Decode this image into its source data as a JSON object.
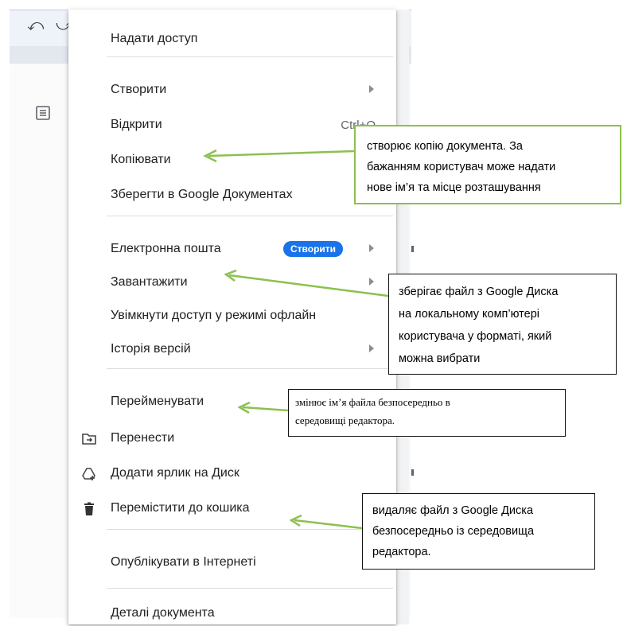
{
  "colors": {
    "accent": "#1a73e8",
    "callout_arrow": "#8cc04f"
  },
  "toolbar": {
    "undo_icon": "undo-icon",
    "redo_icon": "redo-icon"
  },
  "menu": {
    "share": {
      "label": "Надати доступ"
    },
    "create": {
      "label": "Створити"
    },
    "open": {
      "label": "Відкрити",
      "shortcut": "Ctrl+O"
    },
    "copy": {
      "label": "Копіювати"
    },
    "save_docs": {
      "label": "Зберегти в Google Документах"
    },
    "email": {
      "label": "Електронна пошта",
      "badge": "Створити"
    },
    "download": {
      "label": "Завантажити"
    },
    "offline": {
      "label": "Увімкнути доступ у режимі офлайн"
    },
    "history": {
      "label": "Історія версій"
    },
    "rename": {
      "label": "Перейменувати"
    },
    "move": {
      "label": "Перенести",
      "icon": "move-folder-icon"
    },
    "shortcut_add": {
      "label": "Додати ярлик на Диск",
      "icon": "add-drive-shortcut-icon"
    },
    "trash": {
      "label": "Перемістити до кошика",
      "icon": "trash-icon"
    },
    "publish": {
      "label": "Опублікувати в Інтернеті"
    },
    "details": {
      "label": "Деталі документа"
    }
  },
  "callouts": {
    "copy": "створює копію документа. За\nбажанням користувач може надати\nнове ім’я та місце розташування",
    "download": "зберігає файл з Google Диска\nна локальному комп’ютері\nкористувача у форматі, який\nможна вибрати",
    "rename": "змінює ім’я файла безпосередньо в\nсередовищі редактора.",
    "trash": "видаляє файл з Google Диска\nбезпосередньо із середовища\nредактора."
  }
}
